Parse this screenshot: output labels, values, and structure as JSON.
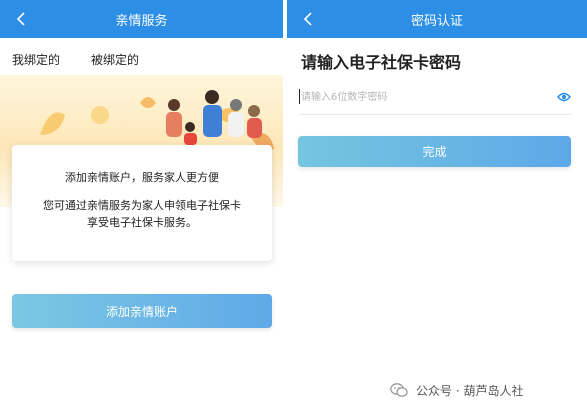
{
  "left": {
    "title": "亲情服务",
    "tabs": [
      {
        "label": "我绑定的",
        "active": true
      },
      {
        "label": "被绑定的",
        "active": false
      }
    ],
    "card": {
      "line1": "添加亲情账户，服务家人更方便",
      "line2": "您可通过亲情服务为家人申领电子社保卡",
      "line3": "享受电子社保卡服务。"
    },
    "add_button_label": "添加亲情账户"
  },
  "right": {
    "title": "密码认证",
    "heading": "请输入电子社保卡密码",
    "password_placeholder": "请输入6位数字密码",
    "password_value": "",
    "done_button_label": "完成"
  },
  "watermark": "公众号 · 葫芦岛人社",
  "colors": {
    "header_blue": "#2d8ee6",
    "button_gradient_start": "#7cc8e2",
    "button_gradient_end": "#5fa9e8",
    "eye_icon": "#2d8ee6"
  }
}
